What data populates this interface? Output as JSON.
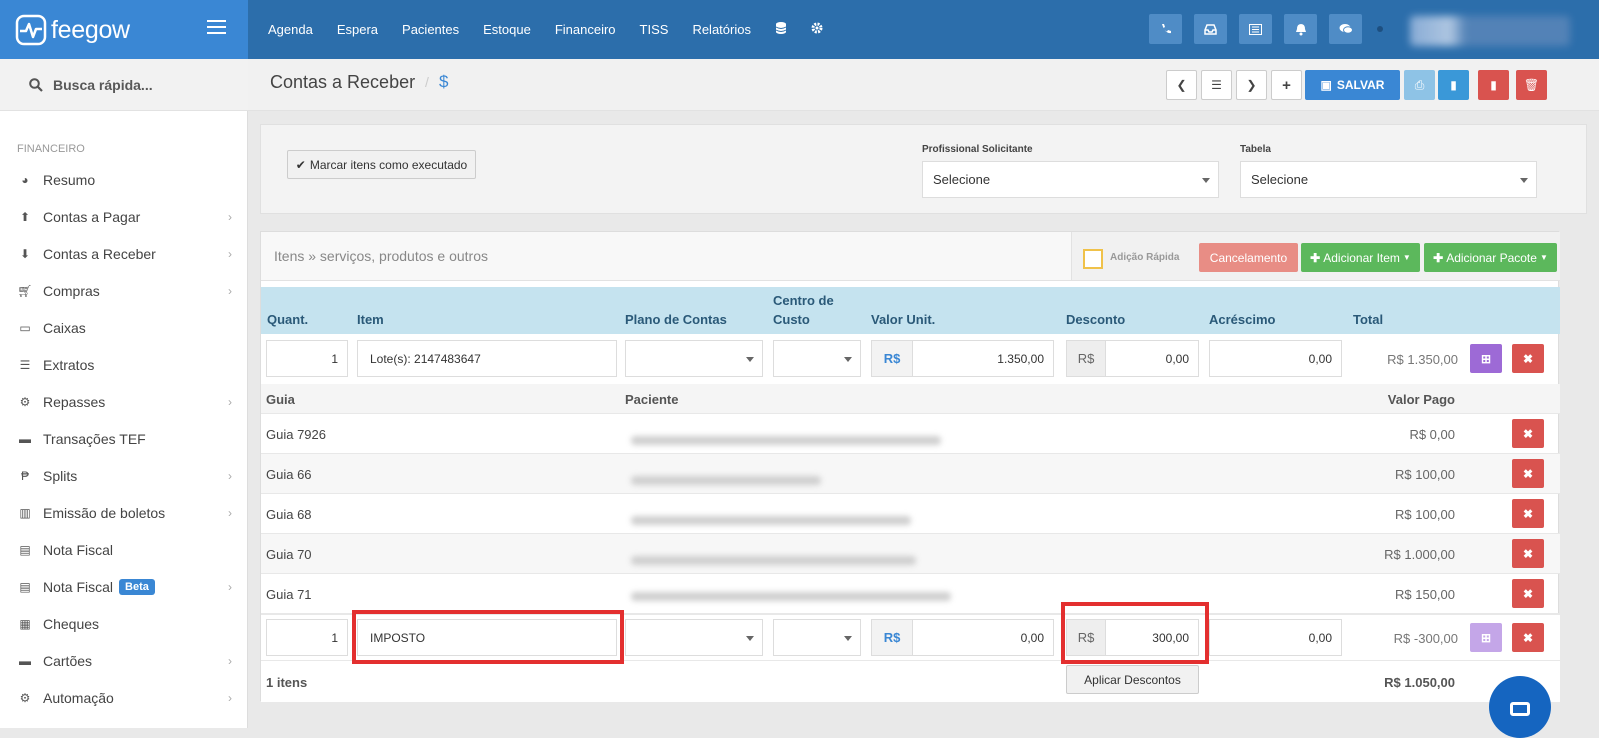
{
  "app": {
    "logo_text": "feegow"
  },
  "topnav": {
    "items": [
      "Agenda",
      "Espera",
      "Pacientes",
      "Estoque",
      "Financeiro",
      "TISS",
      "Relatórios"
    ]
  },
  "sidebar": {
    "search_placeholder": "Busca rápida...",
    "section_header": "FINANCEIRO",
    "items": [
      {
        "label": "Resumo",
        "icon": "pie-chart-icon",
        "has_submenu": false
      },
      {
        "label": "Contas a Pagar",
        "icon": "arrow-up-circle-icon",
        "has_submenu": true
      },
      {
        "label": "Contas a Receber",
        "icon": "arrow-down-circle-icon",
        "has_submenu": true
      },
      {
        "label": "Compras",
        "icon": "cart-icon",
        "has_submenu": true
      },
      {
        "label": "Caixas",
        "icon": "inbox-icon",
        "has_submenu": false
      },
      {
        "label": "Extratos",
        "icon": "list-icon",
        "has_submenu": false
      },
      {
        "label": "Repasses",
        "icon": "sitemap-icon",
        "has_submenu": true
      },
      {
        "label": "Transações TEF",
        "icon": "credit-card-icon",
        "has_submenu": false
      },
      {
        "label": "Splits",
        "icon": "split-icon",
        "has_submenu": true
      },
      {
        "label": "Emissão de boletos",
        "icon": "barcode-icon",
        "has_submenu": true
      },
      {
        "label": "Nota Fiscal",
        "icon": "document-icon",
        "has_submenu": false
      },
      {
        "label": "Nota Fiscal",
        "icon": "document-icon",
        "has_submenu": true,
        "badge": "Beta"
      },
      {
        "label": "Cheques",
        "icon": "cheque-icon",
        "has_submenu": false
      },
      {
        "label": "Cartões",
        "icon": "credit-card-icon",
        "has_submenu": true
      },
      {
        "label": "Automação",
        "icon": "cogs-icon",
        "has_submenu": true
      }
    ]
  },
  "page": {
    "title": "Contas a Receber",
    "separator": "/",
    "currency_symbol": "$",
    "save_label": "SALVAR"
  },
  "top_panel": {
    "mark_executed_label": "Marcar itens como executado",
    "professional_label": "Profissional Solicitante",
    "professional_value": "Selecione",
    "table_label": "Tabela",
    "table_value": "Selecione"
  },
  "items_panel": {
    "title": "Itens » serviços, produtos e outros",
    "quick_add_label": "Adição Rápida",
    "cancel_label": "Cancelamento",
    "add_item_label": "Adicionar Item",
    "add_package_label": "Adicionar Pacote",
    "columns": {
      "quant": "Quant.",
      "item": "Item",
      "plano": "Plano de Contas",
      "centro_1": "Centro de",
      "centro_2": "Custo",
      "valor_unit": "Valor Unit.",
      "desconto": "Desconto",
      "acrescimo": "Acréscimo",
      "total": "Total"
    },
    "currency": "R$",
    "row1": {
      "quant": "1",
      "item": "Lote(s): 2147483647",
      "valor": "1.350,00",
      "desconto": "0,00",
      "acrescimo": "0,00",
      "total": "R$ 1.350,00"
    },
    "sub_columns": {
      "guia": "Guia",
      "paciente": "Paciente",
      "valor_pago": "Valor Pago"
    },
    "guias": [
      {
        "guia": "Guia 7926",
        "valor": "R$ 0,00"
      },
      {
        "guia": "Guia 66",
        "valor": "R$ 100,00"
      },
      {
        "guia": "Guia 68",
        "valor": "R$ 100,00"
      },
      {
        "guia": "Guia 70",
        "valor": "R$ 1.000,00"
      },
      {
        "guia": "Guia 71",
        "valor": "R$ 150,00"
      }
    ],
    "row2": {
      "quant": "1",
      "item": "IMPOSTO",
      "valor": "0,00",
      "desconto": "300,00",
      "acrescimo": "0,00",
      "total": "R$ -300,00"
    },
    "footer": {
      "count": "1 itens",
      "apply_discounts": "Aplicar Descontos",
      "grand_total": "R$ 1.050,00"
    }
  },
  "colors": {
    "topbar": "#2c6eab",
    "logo_bg": "#3a87d4",
    "primary": "#3a87d4",
    "danger": "#d9534f",
    "success": "#5cb85c",
    "highlight": "#e32f2f",
    "header_row": "#c5e3ef"
  }
}
